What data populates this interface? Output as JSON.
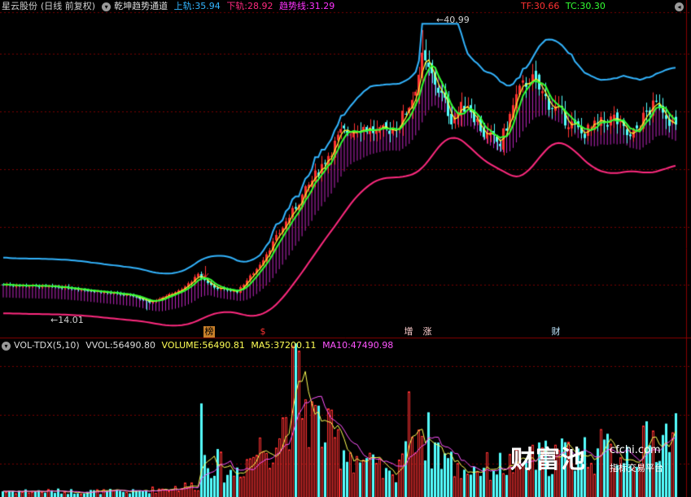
{
  "header": {
    "stock_name": "星云股份",
    "period": "(日线 前复权)",
    "indicator_name": "乾坤趋势通道",
    "upper_label": "上轨:",
    "upper_value": "35.94",
    "lower_label": "下轨:",
    "lower_value": "28.92",
    "trend_label": "趋势线:",
    "trend_value": "31.29",
    "tf_label": "TF:",
    "tf_value": "30.66",
    "tc_label": "TC:",
    "tc_value": "30.30"
  },
  "volume_header": {
    "indicator_name": "VOL-TDX(5,10)",
    "vvol_label": "VVOL:",
    "vvol_value": "56490.80",
    "volume_label": "VOLUME:",
    "volume_value": "56490.81",
    "ma5_label": "MA5:",
    "ma5_value": "37200.11",
    "ma10_label": "MA10:",
    "ma10_value": "47490.98"
  },
  "annotations": {
    "high_price": "40.99",
    "low_price": "14.01"
  },
  "events": [
    {
      "label": "榜"
    },
    {
      "label": "$"
    },
    {
      "label": "增"
    },
    {
      "label": "涨"
    },
    {
      "label": "财"
    }
  ],
  "watermark": {
    "brand": "财富池",
    "site": "cfchi.com",
    "tagline": "指标交易平台"
  },
  "colors": {
    "background": "#000000",
    "up_candle": "#ff3232",
    "down_candle": "#54ffff",
    "upper_band": "#33b5ff",
    "lower_band": "#ff2a7f",
    "trend_line": "#33ff33",
    "tf_line": "#ffff33",
    "fill": "#ff33ff",
    "grid": "#7a0000",
    "ma5": "#ffff55",
    "ma10": "#ff55ff"
  },
  "chart_data": {
    "type": "candlestick",
    "price_range": [
      13.5,
      42
    ],
    "volume_range": [
      0,
      90000
    ],
    "high_marker": 40.99,
    "low_marker": 14.01,
    "last": {
      "upper": 35.94,
      "lower": 28.92,
      "trend": 31.29,
      "tf": 30.66,
      "tc": 30.3
    },
    "close_keypoints": [
      [
        0,
        16.5
      ],
      [
        20,
        16.2
      ],
      [
        40,
        15.4
      ],
      [
        45,
        14.8
      ],
      [
        55,
        16.0
      ],
      [
        60,
        17.4
      ],
      [
        65,
        16.2
      ],
      [
        72,
        15.8
      ],
      [
        78,
        18.0
      ],
      [
        85,
        21.5
      ],
      [
        92,
        25.0
      ],
      [
        98,
        28.0
      ],
      [
        104,
        31.0
      ],
      [
        110,
        31.8
      ],
      [
        116,
        31.0
      ],
      [
        122,
        32.0
      ],
      [
        126,
        34.5
      ],
      [
        129,
        38.0
      ],
      [
        133,
        36.0
      ],
      [
        138,
        32.5
      ],
      [
        143,
        34.0
      ],
      [
        148,
        31.0
      ],
      [
        153,
        30.0
      ],
      [
        158,
        34.5
      ],
      [
        162,
        36.5
      ],
      [
        168,
        34.0
      ],
      [
        173,
        32.5
      ],
      [
        178,
        31.0
      ],
      [
        183,
        31.8
      ],
      [
        188,
        32.5
      ],
      [
        193,
        30.5
      ],
      [
        198,
        33.0
      ],
      [
        202,
        34.0
      ],
      [
        207,
        31.5
      ]
    ],
    "volume_keypoints": [
      [
        0,
        4000
      ],
      [
        40,
        3500
      ],
      [
        60,
        8000
      ],
      [
        61,
        55000
      ],
      [
        62,
        28000
      ],
      [
        70,
        15000
      ],
      [
        78,
        30000
      ],
      [
        85,
        42000
      ],
      [
        90,
        75000
      ],
      [
        94,
        55000
      ],
      [
        100,
        40000
      ],
      [
        110,
        25000
      ],
      [
        120,
        12000
      ],
      [
        126,
        55000
      ],
      [
        130,
        40000
      ],
      [
        140,
        18000
      ],
      [
        160,
        22000
      ],
      [
        170,
        28000
      ],
      [
        180,
        30000
      ],
      [
        195,
        30000
      ],
      [
        207,
        45000
      ]
    ]
  }
}
